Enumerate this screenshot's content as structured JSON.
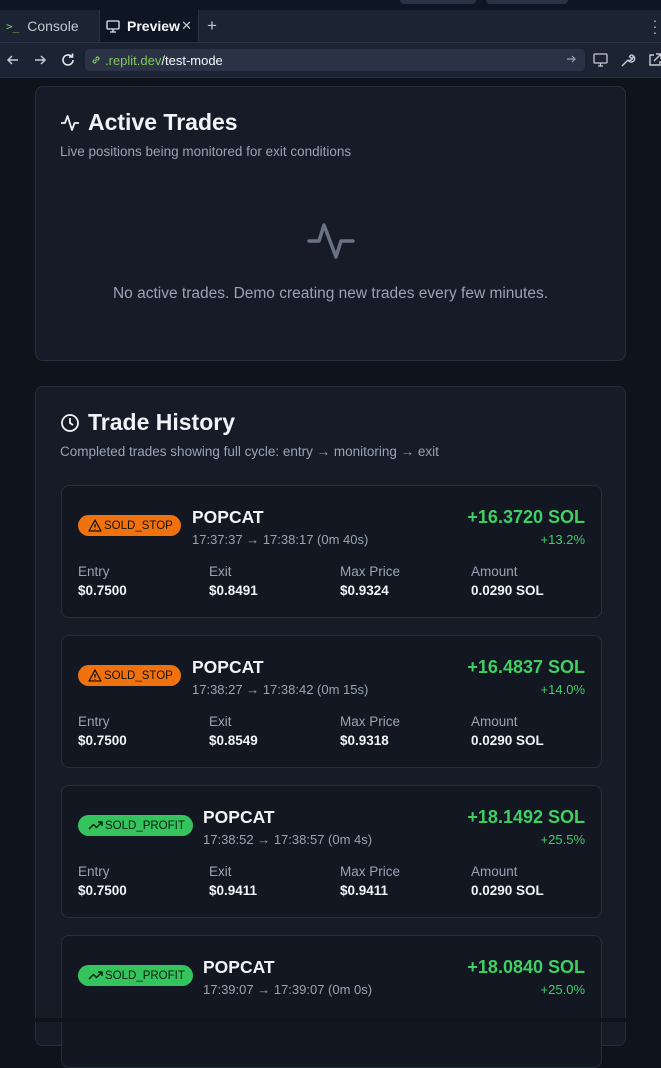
{
  "browser": {
    "tabs": [
      {
        "label": "Console",
        "active": false
      },
      {
        "label": "Preview",
        "active": true
      }
    ],
    "url_host": ".replit.dev",
    "url_path": "/test-mode"
  },
  "active_trades": {
    "title": "Active Trades",
    "subtitle": "Live positions being monitored for exit conditions",
    "empty_message": "No active trades. Demo creating new trades every few minutes."
  },
  "trade_history": {
    "title": "Trade History",
    "subtitle": "Completed trades showing full cycle: entry → monitoring → exit",
    "column_labels": {
      "entry": "Entry",
      "exit": "Exit",
      "max_price": "Max Price",
      "amount": "Amount"
    },
    "trades": [
      {
        "status": "SOLD_STOP",
        "status_icon": "warning-icon",
        "symbol": "POPCAT",
        "times": "17:37:37 → 17:38:17 (0m 40s)",
        "pnl": "+16.3720 SOL",
        "pct": "+13.2%",
        "entry": "$0.7500",
        "exit": "$0.8491",
        "max_price": "$0.9324",
        "amount": "0.0290 SOL"
      },
      {
        "status": "SOLD_STOP",
        "status_icon": "warning-icon",
        "symbol": "POPCAT",
        "times": "17:38:27 → 17:38:42 (0m 15s)",
        "pnl": "+16.4837 SOL",
        "pct": "+14.0%",
        "entry": "$0.7500",
        "exit": "$0.8549",
        "max_price": "$0.9318",
        "amount": "0.0290 SOL"
      },
      {
        "status": "SOLD_PROFIT",
        "status_icon": "trending-up-icon",
        "symbol": "POPCAT",
        "times": "17:38:52 → 17:38:57 (0m 4s)",
        "pnl": "+18.1492 SOL",
        "pct": "+25.5%",
        "entry": "$0.7500",
        "exit": "$0.9411",
        "max_price": "$0.9411",
        "amount": "0.0290 SOL"
      },
      {
        "status": "SOLD_PROFIT",
        "status_icon": "trending-up-icon",
        "symbol": "POPCAT",
        "times": "17:39:07 → 17:39:07 (0m 0s)",
        "pnl": "+18.0840 SOL",
        "pct": "+25.0%",
        "entry": "",
        "exit": "",
        "max_price": "",
        "amount": ""
      }
    ]
  },
  "colors": {
    "background": "#0f131c",
    "card": "#161b27",
    "profit_green": "#3fcf63",
    "stop_orange": "#f0720f"
  }
}
